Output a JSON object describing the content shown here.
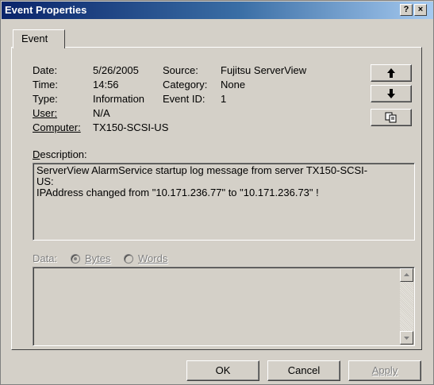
{
  "window": {
    "title": "Event Properties",
    "help_button": "?",
    "close_button": "×"
  },
  "tabs": [
    {
      "label": "Event"
    }
  ],
  "event": {
    "date_label": "Date:",
    "date_value": "5/26/2005",
    "source_label": "Source:",
    "source_value": "Fujitsu ServerView",
    "time_label": "Time:",
    "time_value": "14:56",
    "category_label": "Category:",
    "category_value": "None",
    "type_label": "Type:",
    "type_value": "Information",
    "eventid_label": "Event ID:",
    "eventid_value": "1",
    "user_label": "User:",
    "user_value": "N/A",
    "computer_label": "Computer:",
    "computer_value": "TX150-SCSI-US"
  },
  "description": {
    "label": "Description:",
    "text": "ServerView AlarmService startup log message from server TX150-SCSI-\nUS:\nIPAddress changed from \"10.171.236.77\" to \"10.171.236.73\" !"
  },
  "data": {
    "label": "Data:",
    "bytes_label": "Bytes",
    "words_label": "Words",
    "selected": "Bytes"
  },
  "nav_buttons": {
    "up_icon": "arrow-up-icon",
    "down_icon": "arrow-down-icon",
    "copy_icon": "copy-icon"
  },
  "footer": {
    "ok_label": "OK",
    "cancel_label": "Cancel",
    "apply_label": "Apply"
  }
}
